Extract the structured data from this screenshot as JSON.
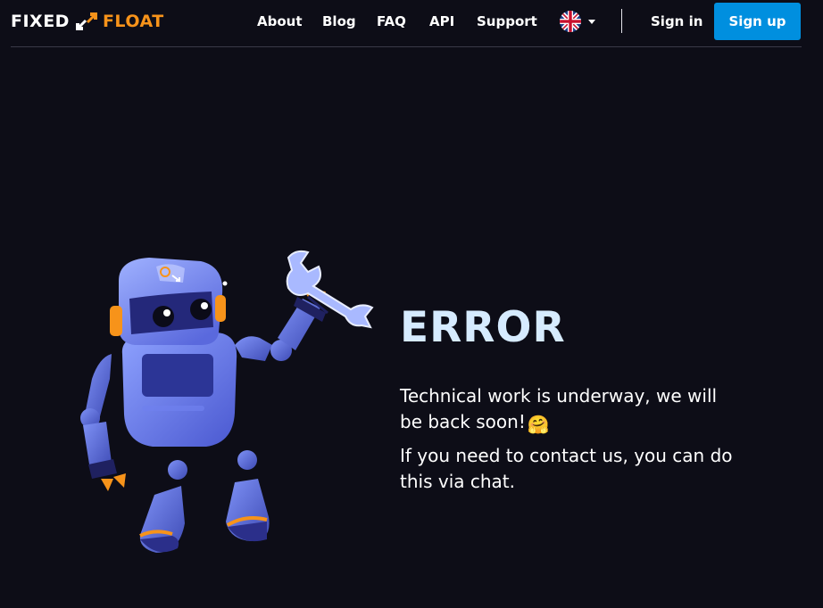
{
  "brand": {
    "left": "FIXED",
    "right": "FLOAT"
  },
  "nav": {
    "items": [
      "About",
      "Blog",
      "FAQ",
      "API",
      "Support"
    ]
  },
  "language": {
    "flag": "uk-flag-icon",
    "chevron": "chevron-down-icon"
  },
  "auth": {
    "signin": "Sign in",
    "signup": "Sign up"
  },
  "error": {
    "title": "ERROR",
    "message1": "Technical work is underway, we will be back soon!",
    "message1_emoji": "🤗",
    "message2": "If you need to contact us, you can do this via chat."
  },
  "colors": {
    "background": "#0d0d17",
    "accent_orange": "#f7931a",
    "button_blue": "#008fdf",
    "title": "#d6ebff"
  }
}
